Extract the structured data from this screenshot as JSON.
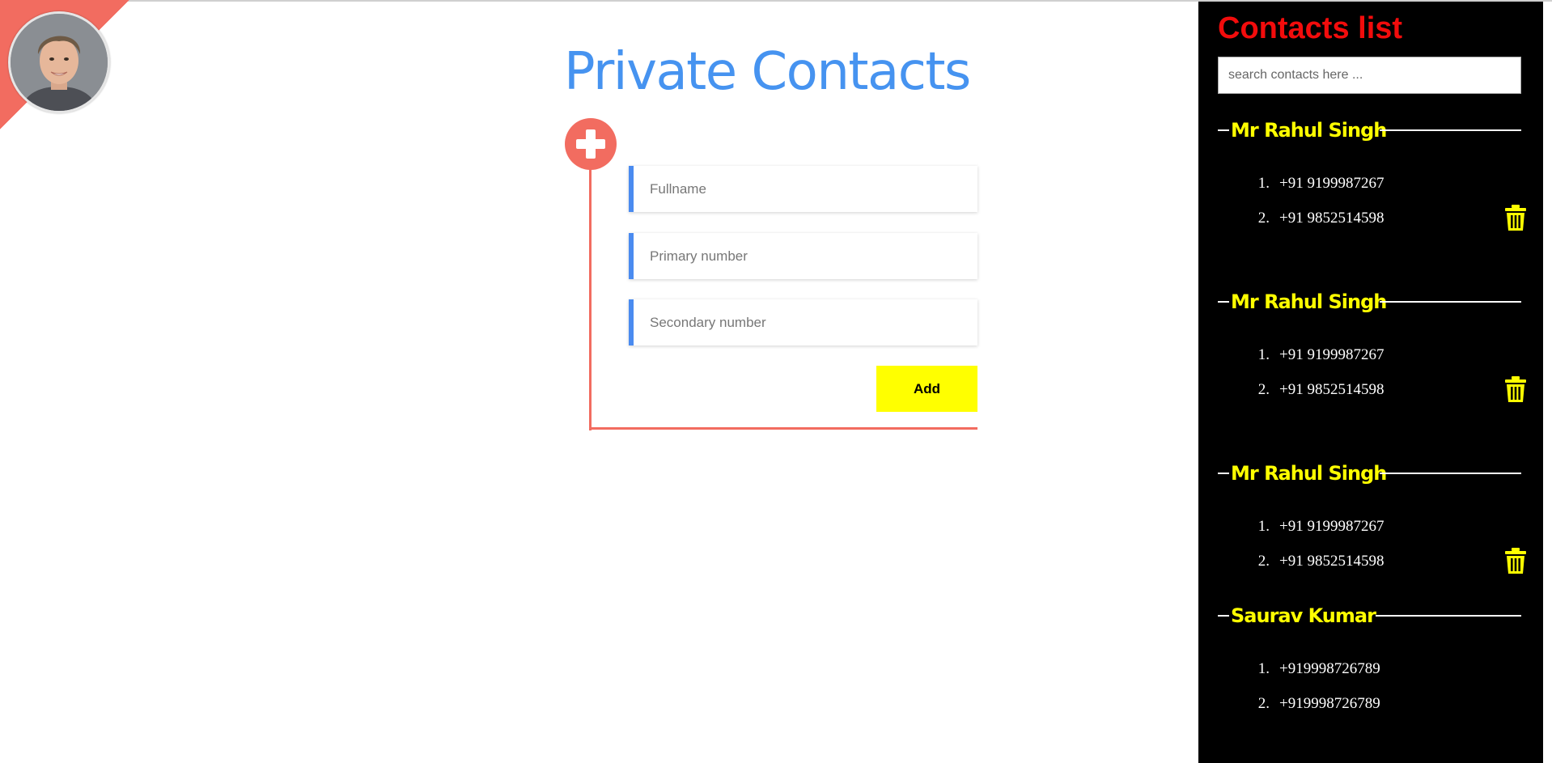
{
  "colors": {
    "accent_red": "#f26c60",
    "accent_blue": "#4693f0",
    "highlight_yellow": "#ffff00",
    "panel_bg": "#000000",
    "panel_title": "#f20c0c"
  },
  "avatar": {
    "icon": "profile-photo"
  },
  "form": {
    "title": "Private Contacts",
    "add_icon": "plus-icon",
    "fields": [
      {
        "placeholder": "Fullname"
      },
      {
        "placeholder": "Primary number"
      },
      {
        "placeholder": "Secondary number"
      }
    ],
    "add_label": "Add"
  },
  "sidebar": {
    "title": "Contacts list",
    "search_placeholder": "search contacts here ...",
    "delete_icon": "trash-icon",
    "contacts": [
      {
        "name": "Mr Rahul Singh",
        "numbers": [
          {
            "idx": "1.",
            "value": "+91 9199987267"
          },
          {
            "idx": "2.",
            "value": "+91 9852514598"
          }
        ]
      },
      {
        "name": "Mr Rahul Singh",
        "numbers": [
          {
            "idx": "1.",
            "value": "+91 9199987267"
          },
          {
            "idx": "2.",
            "value": "+91 9852514598"
          }
        ]
      },
      {
        "name": "Mr Rahul Singh",
        "numbers": [
          {
            "idx": "1.",
            "value": "+91 9199987267"
          },
          {
            "idx": "2.",
            "value": "+91 9852514598"
          }
        ]
      },
      {
        "name": "Saurav Kumar",
        "numbers": [
          {
            "idx": "1.",
            "value": "+919998726789"
          },
          {
            "idx": "2.",
            "value": "+919998726789"
          }
        ]
      }
    ]
  }
}
